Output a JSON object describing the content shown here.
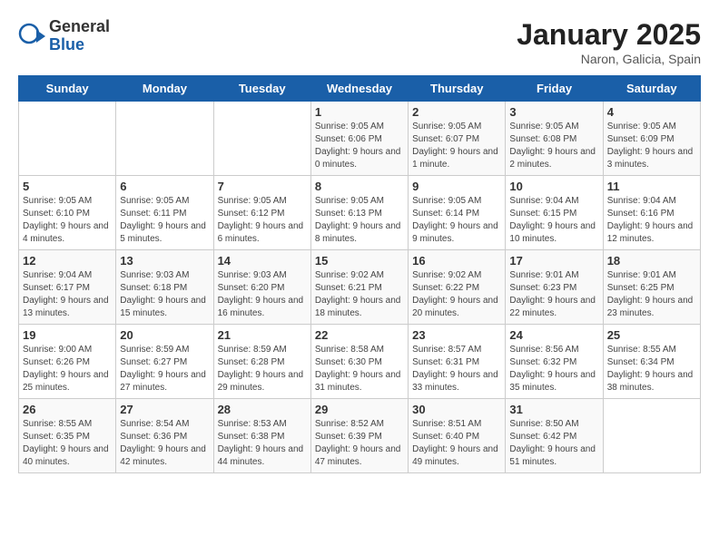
{
  "header": {
    "logo_general": "General",
    "logo_blue": "Blue",
    "title": "January 2025",
    "subtitle": "Naron, Galicia, Spain"
  },
  "days_of_week": [
    "Sunday",
    "Monday",
    "Tuesday",
    "Wednesday",
    "Thursday",
    "Friday",
    "Saturday"
  ],
  "weeks": [
    [
      {
        "day": "",
        "sunrise": "",
        "sunset": "",
        "daylight": ""
      },
      {
        "day": "",
        "sunrise": "",
        "sunset": "",
        "daylight": ""
      },
      {
        "day": "",
        "sunrise": "",
        "sunset": "",
        "daylight": ""
      },
      {
        "day": "1",
        "sunrise": "9:05 AM",
        "sunset": "6:06 PM",
        "daylight": "9 hours and 0 minutes."
      },
      {
        "day": "2",
        "sunrise": "9:05 AM",
        "sunset": "6:07 PM",
        "daylight": "9 hours and 1 minute."
      },
      {
        "day": "3",
        "sunrise": "9:05 AM",
        "sunset": "6:08 PM",
        "daylight": "9 hours and 2 minutes."
      },
      {
        "day": "4",
        "sunrise": "9:05 AM",
        "sunset": "6:09 PM",
        "daylight": "9 hours and 3 minutes."
      }
    ],
    [
      {
        "day": "5",
        "sunrise": "9:05 AM",
        "sunset": "6:10 PM",
        "daylight": "9 hours and 4 minutes."
      },
      {
        "day": "6",
        "sunrise": "9:05 AM",
        "sunset": "6:11 PM",
        "daylight": "9 hours and 5 minutes."
      },
      {
        "day": "7",
        "sunrise": "9:05 AM",
        "sunset": "6:12 PM",
        "daylight": "9 hours and 6 minutes."
      },
      {
        "day": "8",
        "sunrise": "9:05 AM",
        "sunset": "6:13 PM",
        "daylight": "9 hours and 8 minutes."
      },
      {
        "day": "9",
        "sunrise": "9:05 AM",
        "sunset": "6:14 PM",
        "daylight": "9 hours and 9 minutes."
      },
      {
        "day": "10",
        "sunrise": "9:04 AM",
        "sunset": "6:15 PM",
        "daylight": "9 hours and 10 minutes."
      },
      {
        "day": "11",
        "sunrise": "9:04 AM",
        "sunset": "6:16 PM",
        "daylight": "9 hours and 12 minutes."
      }
    ],
    [
      {
        "day": "12",
        "sunrise": "9:04 AM",
        "sunset": "6:17 PM",
        "daylight": "9 hours and 13 minutes."
      },
      {
        "day": "13",
        "sunrise": "9:03 AM",
        "sunset": "6:18 PM",
        "daylight": "9 hours and 15 minutes."
      },
      {
        "day": "14",
        "sunrise": "9:03 AM",
        "sunset": "6:20 PM",
        "daylight": "9 hours and 16 minutes."
      },
      {
        "day": "15",
        "sunrise": "9:02 AM",
        "sunset": "6:21 PM",
        "daylight": "9 hours and 18 minutes."
      },
      {
        "day": "16",
        "sunrise": "9:02 AM",
        "sunset": "6:22 PM",
        "daylight": "9 hours and 20 minutes."
      },
      {
        "day": "17",
        "sunrise": "9:01 AM",
        "sunset": "6:23 PM",
        "daylight": "9 hours and 22 minutes."
      },
      {
        "day": "18",
        "sunrise": "9:01 AM",
        "sunset": "6:25 PM",
        "daylight": "9 hours and 23 minutes."
      }
    ],
    [
      {
        "day": "19",
        "sunrise": "9:00 AM",
        "sunset": "6:26 PM",
        "daylight": "9 hours and 25 minutes."
      },
      {
        "day": "20",
        "sunrise": "8:59 AM",
        "sunset": "6:27 PM",
        "daylight": "9 hours and 27 minutes."
      },
      {
        "day": "21",
        "sunrise": "8:59 AM",
        "sunset": "6:28 PM",
        "daylight": "9 hours and 29 minutes."
      },
      {
        "day": "22",
        "sunrise": "8:58 AM",
        "sunset": "6:30 PM",
        "daylight": "9 hours and 31 minutes."
      },
      {
        "day": "23",
        "sunrise": "8:57 AM",
        "sunset": "6:31 PM",
        "daylight": "9 hours and 33 minutes."
      },
      {
        "day": "24",
        "sunrise": "8:56 AM",
        "sunset": "6:32 PM",
        "daylight": "9 hours and 35 minutes."
      },
      {
        "day": "25",
        "sunrise": "8:55 AM",
        "sunset": "6:34 PM",
        "daylight": "9 hours and 38 minutes."
      }
    ],
    [
      {
        "day": "26",
        "sunrise": "8:55 AM",
        "sunset": "6:35 PM",
        "daylight": "9 hours and 40 minutes."
      },
      {
        "day": "27",
        "sunrise": "8:54 AM",
        "sunset": "6:36 PM",
        "daylight": "9 hours and 42 minutes."
      },
      {
        "day": "28",
        "sunrise": "8:53 AM",
        "sunset": "6:38 PM",
        "daylight": "9 hours and 44 minutes."
      },
      {
        "day": "29",
        "sunrise": "8:52 AM",
        "sunset": "6:39 PM",
        "daylight": "9 hours and 47 minutes."
      },
      {
        "day": "30",
        "sunrise": "8:51 AM",
        "sunset": "6:40 PM",
        "daylight": "9 hours and 49 minutes."
      },
      {
        "day": "31",
        "sunrise": "8:50 AM",
        "sunset": "6:42 PM",
        "daylight": "9 hours and 51 minutes."
      },
      {
        "day": "",
        "sunrise": "",
        "sunset": "",
        "daylight": ""
      }
    ]
  ]
}
